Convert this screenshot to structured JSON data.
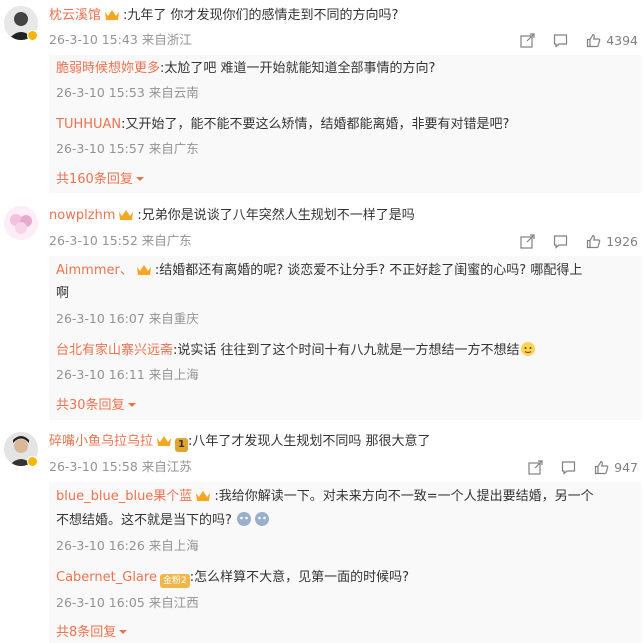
{
  "comments": [
    {
      "author": "枕云溪馆",
      "text": ":九年了 你才发现你们的感情走到不同的方向吗?",
      "meta": "26-3-10 15:43 来自浙江",
      "likes": "4394",
      "replies": [
        {
          "author": "脆弱時候想妳更多",
          "text": ":太尬了吧 难道一开始就能知道全部事情的方向?",
          "meta": "26-3-10 15:53 来自云南"
        },
        {
          "author": "TUHHUAN",
          "text": ":又开始了，能不能不要这么矫情，结婚都能离婚，非要有对错是吧?",
          "meta": "26-3-10 15:57 来自广东"
        }
      ],
      "more_replies": "共160条回复"
    },
    {
      "author": "nowplzhm",
      "text": ":兄弟你是说谈了八年突然人生规划不一样了是吗",
      "meta": "26-3-10 15:52 来自广东",
      "likes": "1926",
      "replies": [
        {
          "author": "Aimmmer、",
          "text": ":结婚都还有离婚的呢? 谈恋爱不让分手? 不正好趁了闺蜜的心吗? 哪配得上",
          "text2": "啊",
          "meta": "26-3-10 16:07 来自重庆"
        },
        {
          "author": "台北有家山寨兴远斋",
          "text": ":说实话 往往到了这个时间十有八九就是一方想结一方不想结",
          "meta": "26-3-10 16:11 来自上海"
        }
      ],
      "more_replies": "共30条回复"
    },
    {
      "author": "碎嘴小鱼乌拉乌拉",
      "text": ":八年了才发现人生规划不同吗 那很大意了",
      "meta": "26-3-10 15:58 来自江苏",
      "likes": "947",
      "badge_level": "1",
      "replies": [
        {
          "author": "blue_blue_blue果个蓝",
          "text": ":我给你解读一下。对未来方向不一致=一个人提出要结婚，另一个",
          "text2": "不想结婚。这不就是当下的吗?",
          "meta": "26-3-10 16:26 来自上海"
        },
        {
          "author": "Cabernet_Glare",
          "text": ":怎么样算不大意，见第一面的时候吗?",
          "meta": "26-3-10 16:05 来自江西",
          "badge": "金粉2"
        }
      ],
      "more_replies": "共8条回复"
    }
  ],
  "colors": {
    "name": "#eb7350",
    "text": "#333333",
    "meta": "#939393",
    "reply_bg": "#f9f9f9"
  },
  "icons": [
    "share-icon",
    "comment-icon",
    "like-icon",
    "chevron-down-icon",
    "vip-crown-icon"
  ]
}
